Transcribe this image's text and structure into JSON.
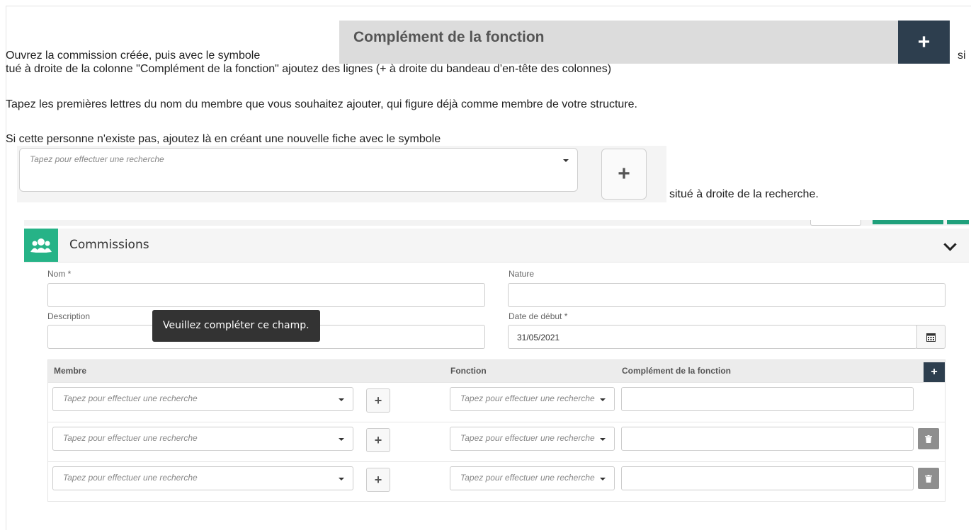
{
  "instructions": {
    "line1_prefix": "Ouvrez la commission créée, puis avec le symbole",
    "line1_suffix": "si",
    "line2": "tué à droite de la colonne \"Complément de la fonction\" ajoutez des lignes (+ à droite du bandeau d’en-tête des colonnes)",
    "line3": "Tapez les premières lettres du nom du membre que vous souhaitez ajouter, qui figure déjà comme membre de votre structure.",
    "line4": "Si cette personne n'existe pas, ajoutez là en créant une nouvelle fiche avec le symbole",
    "line5": "situé à droite de la recherche."
  },
  "image1": {
    "header_label": "Complément de la fonction",
    "button_symbol": "+"
  },
  "image2": {
    "placeholder": "Tapez pour effectuer une recherche",
    "button_symbol": "+"
  },
  "panel": {
    "title": "Commissions",
    "icon": "group-icon",
    "accent": "#26b387",
    "form": {
      "nom_label": "Nom *",
      "nature_label": "Nature",
      "description_label": "Description",
      "date_label": "Date de début *",
      "date_value": "31/05/2021",
      "tooltip": "Veuillez compléter ce champ."
    },
    "table": {
      "columns": [
        "Membre",
        "Fonction",
        "Complément de la fonction"
      ],
      "add_symbol": "+",
      "rows": [
        {
          "membre_placeholder": "Tapez pour effectuer une recherche",
          "fonction_placeholder": "Tapez pour effectuer une recherche"
        },
        {
          "membre_placeholder": "Tapez pour effectuer une recherche",
          "fonction_placeholder": "Tapez pour effectuer une recherche"
        },
        {
          "membre_placeholder": "Tapez pour effectuer une recherche",
          "fonction_placeholder": "Tapez pour effectuer une recherche"
        }
      ],
      "row_plus_symbol": "+"
    }
  }
}
